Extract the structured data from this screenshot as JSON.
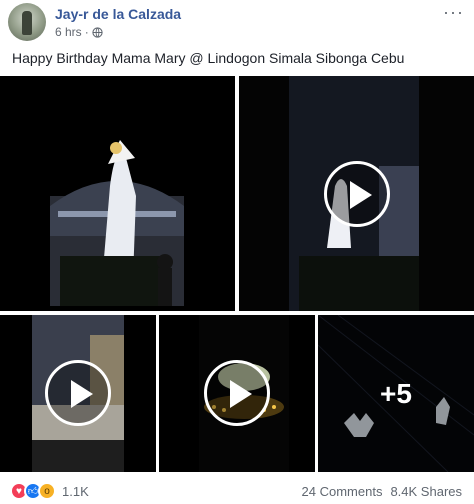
{
  "post": {
    "author": "Jay-r de la Calzada",
    "time": "6 hrs",
    "privacy_icon": "globe-icon",
    "text": "Happy Birthday Mama Mary @ Lindogon Simala Sibonga Cebu",
    "more_label": "···"
  },
  "media": {
    "more_count_label": "+5",
    "items": [
      {
        "kind": "photo"
      },
      {
        "kind": "video"
      },
      {
        "kind": "video"
      },
      {
        "kind": "video"
      },
      {
        "kind": "photo-overlay"
      }
    ]
  },
  "footer": {
    "reactions": [
      "love-icon",
      "like-icon",
      "wow-icon"
    ],
    "reaction_count": "1.1K",
    "comments": "24 Comments",
    "shares": "8.4K Shares"
  },
  "colors": {
    "author": "#385898",
    "love": "#f33e58",
    "like": "#1877f2",
    "wow": "#f7b125"
  }
}
